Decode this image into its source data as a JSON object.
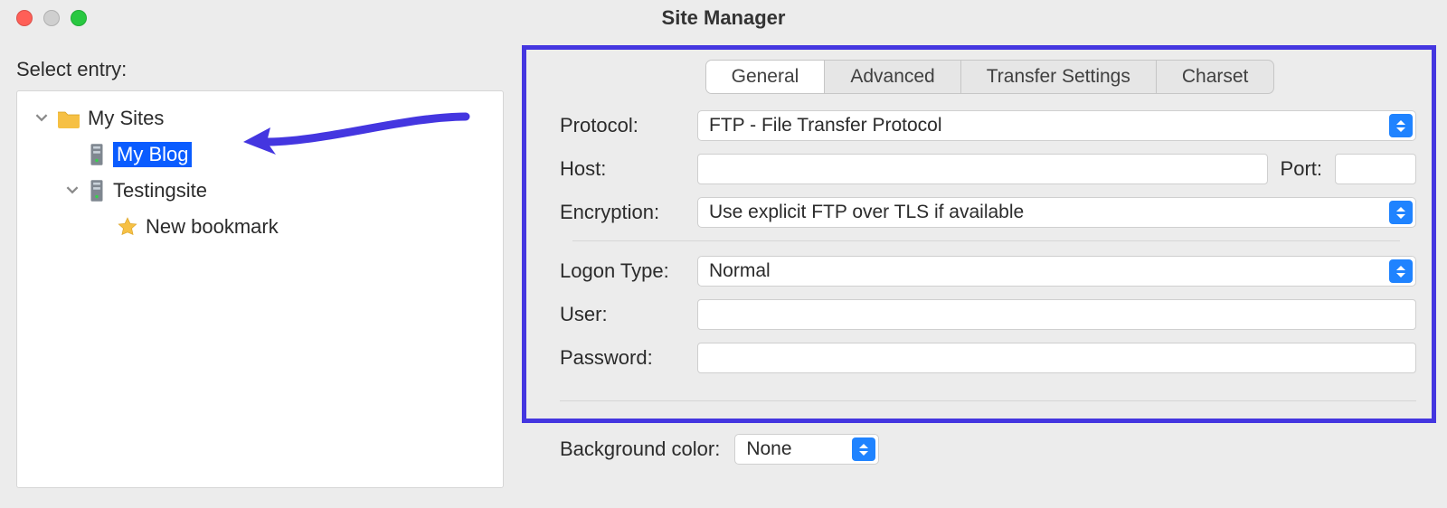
{
  "window": {
    "title": "Site Manager"
  },
  "sidebar": {
    "heading": "Select entry:",
    "root": {
      "label": "My Sites",
      "children": [
        {
          "label": "My Blog",
          "selected": true
        },
        {
          "label": "Testingsite",
          "children": [
            {
              "label": "New bookmark",
              "star": true
            }
          ]
        }
      ]
    }
  },
  "tabs": [
    "General",
    "Advanced",
    "Transfer Settings",
    "Charset"
  ],
  "active_tab": "General",
  "form": {
    "protocol_label": "Protocol:",
    "protocol_value": "FTP - File Transfer Protocol",
    "host_label": "Host:",
    "host_value": "",
    "port_label": "Port:",
    "port_value": "",
    "encryption_label": "Encryption:",
    "encryption_value": "Use explicit FTP over TLS if available",
    "logon_label": "Logon Type:",
    "logon_value": "Normal",
    "user_label": "User:",
    "user_value": "",
    "password_label": "Password:",
    "password_value": "",
    "bgcolor_label": "Background color:",
    "bgcolor_value": "None"
  },
  "annotation": {
    "arrow_color": "#4436e0",
    "highlight_color": "#4436e0"
  }
}
